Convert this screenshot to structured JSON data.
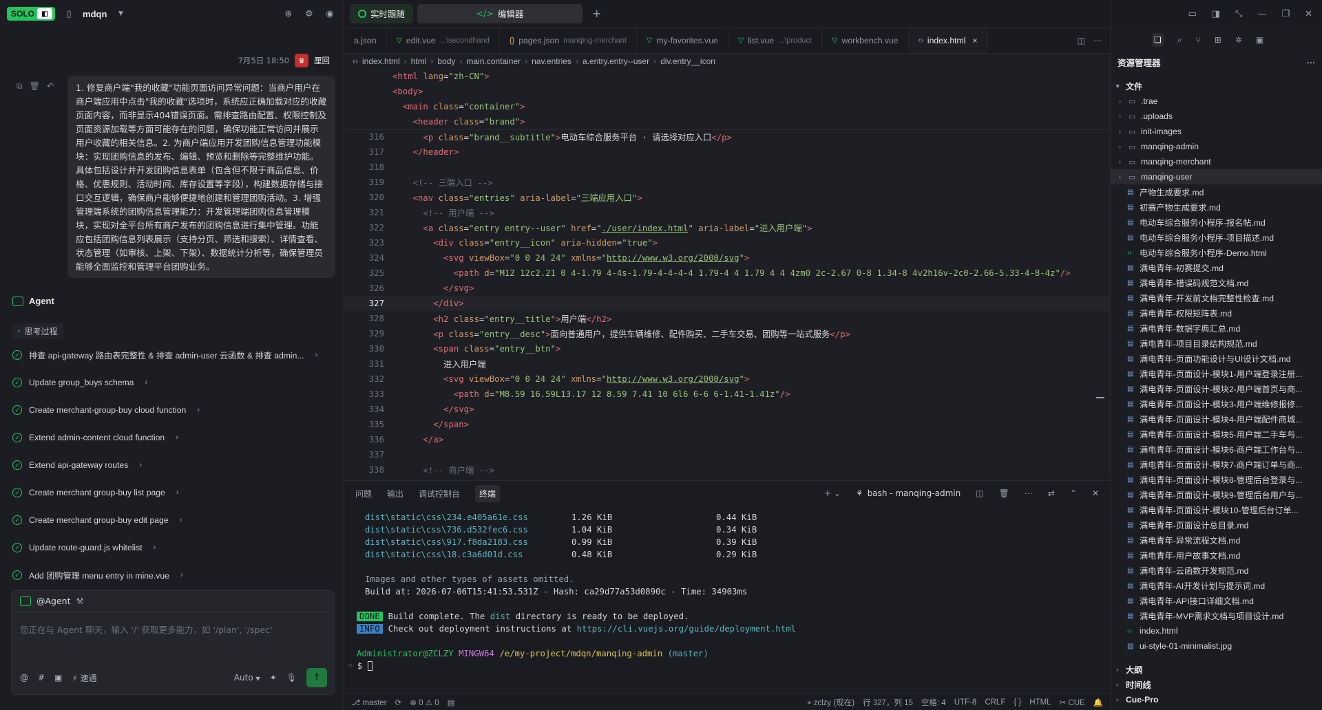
{
  "left": {
    "logo": "SOLO",
    "project": "mdqn",
    "message": {
      "time": "7月5日 18:50",
      "user": "厘回",
      "text": "1. 修复商户端\"我的收藏\"功能页面访问异常问题：当商户用户在商户端应用中点击\"我的收藏\"选项时，系统应正确加载对应的收藏页面内容，而非显示404错误页面。需排查路由配置、权限控制及页面资源加载等方面可能存在的问题，确保功能正常访问并展示用户收藏的相关信息。2. 为商户端应用开发团购信息管理功能模块：实现团购信息的发布、编辑、预览和删除等完整维护功能。具体包括设计并开发团购信息表单（包含但不限于商品信息、价格、优惠规则、活动时间、库存设置等字段），构建数据存储与接口交互逻辑，确保商户能够便捷地创建和管理团购活动。3. 增强管理端系统的团购信息管理能力：开发管理端团购信息管理模块，实现对全平台所有商户发布的团购信息进行集中管理。功能应包括团购信息列表展示（支持分页、筛选和搜索）、详情查看、状态管理（如审核、上架、下架）、数据统计分析等，确保管理员能够全面监控和管理平台团购业务。"
    },
    "agent_label": "Agent",
    "thinking_label": "思考过程",
    "steps": [
      "排查 api-gateway 路由表完整性 & 排查 admin-user 云函数 & 排查 admin...",
      "Update group_buys schema",
      "Create merchant-group-buy cloud function",
      "Extend admin-content cloud function",
      "Extend api-gateway routes",
      "Create merchant group-buy list page",
      "Create merchant group-buy edit page",
      "Update route-guard.js whitelist",
      "Add 团购管理 menu entry in mine.vue"
    ],
    "composer": {
      "header": "@Agent",
      "placeholder": "您正在与 Agent 聊天，输入 '/' 获取更多能力，如 '/plan', '/spec'",
      "speed": "速通",
      "mode": "Auto"
    }
  },
  "editor": {
    "top_tabs": [
      "实时跟随",
      "编辑器"
    ],
    "file_tabs": [
      {
        "icon": "json",
        "name": "a.json",
        "sub": ""
      },
      {
        "icon": "vue",
        "name": "edit.vue",
        "sub": "...\\secondhand"
      },
      {
        "icon": "json",
        "name": "pages.json",
        "sub": "manqing-merchant"
      },
      {
        "icon": "vue",
        "name": "my-favorites.vue",
        "sub": ""
      },
      {
        "icon": "vue",
        "name": "list.vue",
        "sub": "...\\product"
      },
      {
        "icon": "vue",
        "name": "workbench.vue",
        "sub": ""
      },
      {
        "icon": "html",
        "name": "index.html",
        "sub": ""
      }
    ],
    "breadcrumb": [
      "index.html",
      "html",
      "body",
      "main.container",
      "nav.entries",
      "a.entry.entry--user",
      "div.entry__icon"
    ],
    "sticky_lines": [
      "<html lang=\"zh-CN\">",
      "<body>",
      "  <main class=\"container\">",
      "    <header class=\"brand\">"
    ],
    "lines": [
      {
        "n": "316",
        "text": "      <p class=\"brand__subtitle\">电动车综合服务平台 · 请选择对应入口</p>"
      },
      {
        "n": "317",
        "text": "    </header>"
      },
      {
        "n": "318",
        "text": ""
      },
      {
        "n": "319",
        "text": "    <!-- 三端入口 -->"
      },
      {
        "n": "320",
        "text": "    <nav class=\"entries\" aria-label=\"三端应用入口\">"
      },
      {
        "n": "321",
        "text": "      <!-- 用户端 -->"
      },
      {
        "n": "322",
        "text": "      <a class=\"entry entry--user\" href=\"./user/index.html\" aria-label=\"进入用户端\">"
      },
      {
        "n": "323",
        "text": "        <div class=\"entry__icon\" aria-hidden=\"true\">"
      },
      {
        "n": "324",
        "text": "          <svg viewBox=\"0 0 24 24\" xmlns=\"http://www.w3.org/2000/svg\">"
      },
      {
        "n": "325",
        "text": "            <path d=\"M12 12c2.21 0 4-1.79 4-4s-1.79-4-4-4-4 1.79-4 4 1.79 4 4 4zm0 2c-2.67 0-8 1.34-8 4v2h16v-2c0-2.66-5.33-4-8-4z\"/>"
      },
      {
        "n": "326",
        "text": "          </svg>"
      },
      {
        "n": "327",
        "text": "        </div>"
      },
      {
        "n": "328",
        "text": "        <h2 class=\"entry__title\">用户端</h2>"
      },
      {
        "n": "329",
        "text": "        <p class=\"entry__desc\">面向普通用户，提供车辆维修、配件购买、二手车交易、团购等一站式服务</p>"
      },
      {
        "n": "330",
        "text": "        <span class=\"entry__btn\">"
      },
      {
        "n": "331",
        "text": "          进入用户端"
      },
      {
        "n": "332",
        "text": "          <svg viewBox=\"0 0 24 24\" xmlns=\"http://www.w3.org/2000/svg\">"
      },
      {
        "n": "333",
        "text": "            <path d=\"M8.59 16.59L13.17 12 8.59 7.41 10 6l6 6-6 6-1.41-1.41z\"/>"
      },
      {
        "n": "334",
        "text": "          </svg>"
      },
      {
        "n": "335",
        "text": "        </span>"
      },
      {
        "n": "336",
        "text": "      </a>"
      },
      {
        "n": "337",
        "text": ""
      },
      {
        "n": "338",
        "text": "      <!-- 商户端 -->"
      }
    ],
    "current_line": "327"
  },
  "terminal": {
    "tabs": [
      "问题",
      "输出",
      "调试控制台",
      "终端"
    ],
    "active_tab": "终端",
    "shell": "bash - manqing-admin",
    "rows": [
      {
        "file": "dist\\static\\css\\234.e405a61e.css",
        "size": "1.26 KiB",
        "gz": "0.44 KiB"
      },
      {
        "file": "dist\\static\\css\\736.d532fec6.css",
        "size": "1.04 KiB",
        "gz": "0.34 KiB"
      },
      {
        "file": "dist\\static\\css\\917.f8da2183.css",
        "size": "0.99 KiB",
        "gz": "0.39 KiB"
      },
      {
        "file": "dist\\static\\css\\18.c3a6d01d.css",
        "size": "0.48 KiB",
        "gz": "0.29 KiB"
      }
    ],
    "omitted": "Images and other types of assets omitted.",
    "build_line": "Build at: 2026-07-06T15:41:53.531Z - Hash: ca29d77a53d0890c - Time: 34903ms",
    "done_badge": "DONE",
    "done_pre": "Build complete. The ",
    "done_dist": "dist",
    "done_post": " directory is ready to be deployed.",
    "info_badge": "INFO",
    "info_pre": "Check out deployment instructions at ",
    "info_url": "https://cli.vuejs.org/guide/deployment.html",
    "prompt_user": "Administrator@ZCLZY",
    "prompt_env": "MINGW64",
    "prompt_path": "/e/my-project/mdqn/manqing-admin",
    "prompt_branch": "(master)",
    "prompt_symbol": "$"
  },
  "status": {
    "branch": "master",
    "errors": "0",
    "warnings": "0",
    "user": "zclzy (现在)",
    "position": "行 327，列 15",
    "indent": "空格: 4",
    "encoding": "UTF-8",
    "eol": "CRLF",
    "braces": "{ }",
    "lang": "HTML",
    "extra": "CUE"
  },
  "explorer": {
    "title": "资源管理器",
    "section_files": "文件",
    "folders": [
      ".trae",
      ".uploads",
      "init-images",
      "manqing-admin",
      "manqing-merchant",
      "manqing-user"
    ],
    "highlighted": "manqing-user",
    "files": [
      {
        "t": "md",
        "name": "产物生成要求.md"
      },
      {
        "t": "md",
        "name": "初赛产物生成要求.md"
      },
      {
        "t": "md",
        "name": "电动车综合服务小程序-报名帖.md"
      },
      {
        "t": "md",
        "name": "电动车综合服务小程序-项目描述.md"
      },
      {
        "t": "html",
        "name": "电动车综合服务小程序-Demo.html"
      },
      {
        "t": "md",
        "name": "满电青年-初赛提交.md"
      },
      {
        "t": "md",
        "name": "满电青年-错误码规范文档.md"
      },
      {
        "t": "md",
        "name": "满电青年-开发前文档完整性检查.md"
      },
      {
        "t": "md",
        "name": "满电青年-权限矩阵表.md"
      },
      {
        "t": "md",
        "name": "满电青年-数据字典汇总.md"
      },
      {
        "t": "md",
        "name": "满电青年-项目目录结构规范.md"
      },
      {
        "t": "md",
        "name": "满电青年-页面功能设计与UI设计文档.md"
      },
      {
        "t": "md",
        "name": "满电青年-页面设计-模块1-用户端登录注册..."
      },
      {
        "t": "md",
        "name": "满电青年-页面设计-模块2-用户端首页与商..."
      },
      {
        "t": "md",
        "name": "满电青年-页面设计-模块3-用户端维修报修..."
      },
      {
        "t": "md",
        "name": "满电青年-页面设计-模块4-用户端配件商城..."
      },
      {
        "t": "md",
        "name": "满电青年-页面设计-模块5-用户端二手车与..."
      },
      {
        "t": "md",
        "name": "满电青年-页面设计-模块6-商户端工作台与..."
      },
      {
        "t": "md",
        "name": "满电青年-页面设计-模块7-商户端订单与商..."
      },
      {
        "t": "md",
        "name": "满电青年-页面设计-模块8-管理后台登录与..."
      },
      {
        "t": "md",
        "name": "满电青年-页面设计-模块9-管理后台用户与..."
      },
      {
        "t": "md",
        "name": "满电青年-页面设计-模块10-管理后台订单..."
      },
      {
        "t": "md",
        "name": "满电青年-页面设计总目录.md"
      },
      {
        "t": "md",
        "name": "满电青年-异常流程文档.md"
      },
      {
        "t": "md",
        "name": "满电青年-用户故事文档.md"
      },
      {
        "t": "md",
        "name": "满电青年-云函数开发规范.md"
      },
      {
        "t": "md",
        "name": "满电青年-AI开发计划与提示词.md"
      },
      {
        "t": "md",
        "name": "满电青年-API接口详细文档.md"
      },
      {
        "t": "md",
        "name": "满电青年-MVP需求文档与项目设计.md"
      },
      {
        "t": "html",
        "name": "index.html"
      },
      {
        "t": "img",
        "name": "ui-style-01-minimalist.jpg"
      }
    ],
    "sections": [
      "大纲",
      "时间线",
      "Cue-Pro"
    ]
  }
}
